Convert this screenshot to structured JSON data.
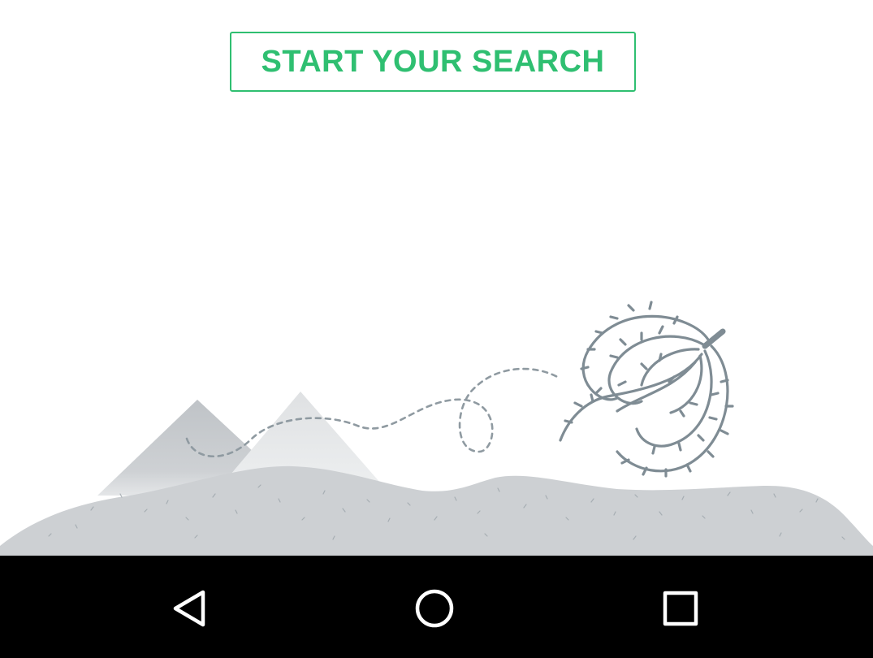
{
  "main": {
    "start_search_label": "START YOUR SEARCH"
  },
  "illustration": {
    "name": "tumbleweed-desert-empty-state",
    "colors": {
      "ground": "#cdd0d3",
      "mountain_dark": "#c2c6ca",
      "mountain_light": "#e3e5e7",
      "tumbleweed": "#7f8c94",
      "path": "#8f9aa1"
    }
  },
  "navigation_bar": {
    "back_icon": "back-triangle-icon",
    "home_icon": "home-circle-icon",
    "recents_icon": "recents-square-icon"
  },
  "theme": {
    "accent": "#2fbf71",
    "navbar_bg": "#000000",
    "nav_icon_color": "#ffffff"
  }
}
